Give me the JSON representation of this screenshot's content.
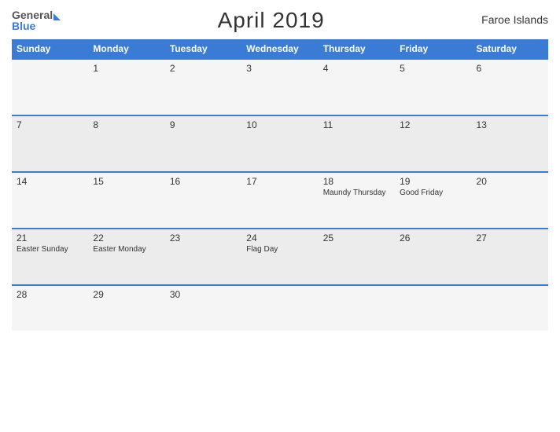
{
  "header": {
    "logo": {
      "general": "General",
      "blue": "Blue"
    },
    "title": "April 2019",
    "region": "Faroe Islands"
  },
  "weekdays": [
    "Sunday",
    "Monday",
    "Tuesday",
    "Wednesday",
    "Thursday",
    "Friday",
    "Saturday"
  ],
  "weeks": [
    [
      {
        "num": "",
        "events": []
      },
      {
        "num": "1",
        "events": []
      },
      {
        "num": "2",
        "events": []
      },
      {
        "num": "3",
        "events": []
      },
      {
        "num": "4",
        "events": []
      },
      {
        "num": "5",
        "events": []
      },
      {
        "num": "6",
        "events": []
      }
    ],
    [
      {
        "num": "7",
        "events": []
      },
      {
        "num": "8",
        "events": []
      },
      {
        "num": "9",
        "events": []
      },
      {
        "num": "10",
        "events": []
      },
      {
        "num": "11",
        "events": []
      },
      {
        "num": "12",
        "events": []
      },
      {
        "num": "13",
        "events": []
      }
    ],
    [
      {
        "num": "14",
        "events": []
      },
      {
        "num": "15",
        "events": []
      },
      {
        "num": "16",
        "events": []
      },
      {
        "num": "17",
        "events": []
      },
      {
        "num": "18",
        "events": [
          "Maundy Thursday"
        ]
      },
      {
        "num": "19",
        "events": [
          "Good Friday"
        ]
      },
      {
        "num": "20",
        "events": []
      }
    ],
    [
      {
        "num": "21",
        "events": [
          "Easter Sunday"
        ]
      },
      {
        "num": "22",
        "events": [
          "Easter Monday"
        ]
      },
      {
        "num": "23",
        "events": []
      },
      {
        "num": "24",
        "events": [
          "Flag Day"
        ]
      },
      {
        "num": "25",
        "events": []
      },
      {
        "num": "26",
        "events": []
      },
      {
        "num": "27",
        "events": []
      }
    ],
    [
      {
        "num": "28",
        "events": []
      },
      {
        "num": "29",
        "events": []
      },
      {
        "num": "30",
        "events": []
      },
      {
        "num": "",
        "events": []
      },
      {
        "num": "",
        "events": []
      },
      {
        "num": "",
        "events": []
      },
      {
        "num": "",
        "events": []
      }
    ]
  ]
}
